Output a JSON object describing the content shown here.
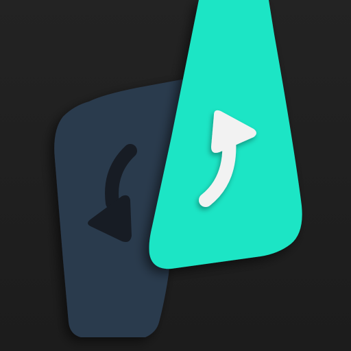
{
  "icon": {
    "background_color": "#1f1f1f",
    "back_card_color": "#2c3a4e",
    "front_card_color": "#1de5c5",
    "undo_arrow_color": "#171c24",
    "redo_arrow_color": "#f2f2f2"
  }
}
